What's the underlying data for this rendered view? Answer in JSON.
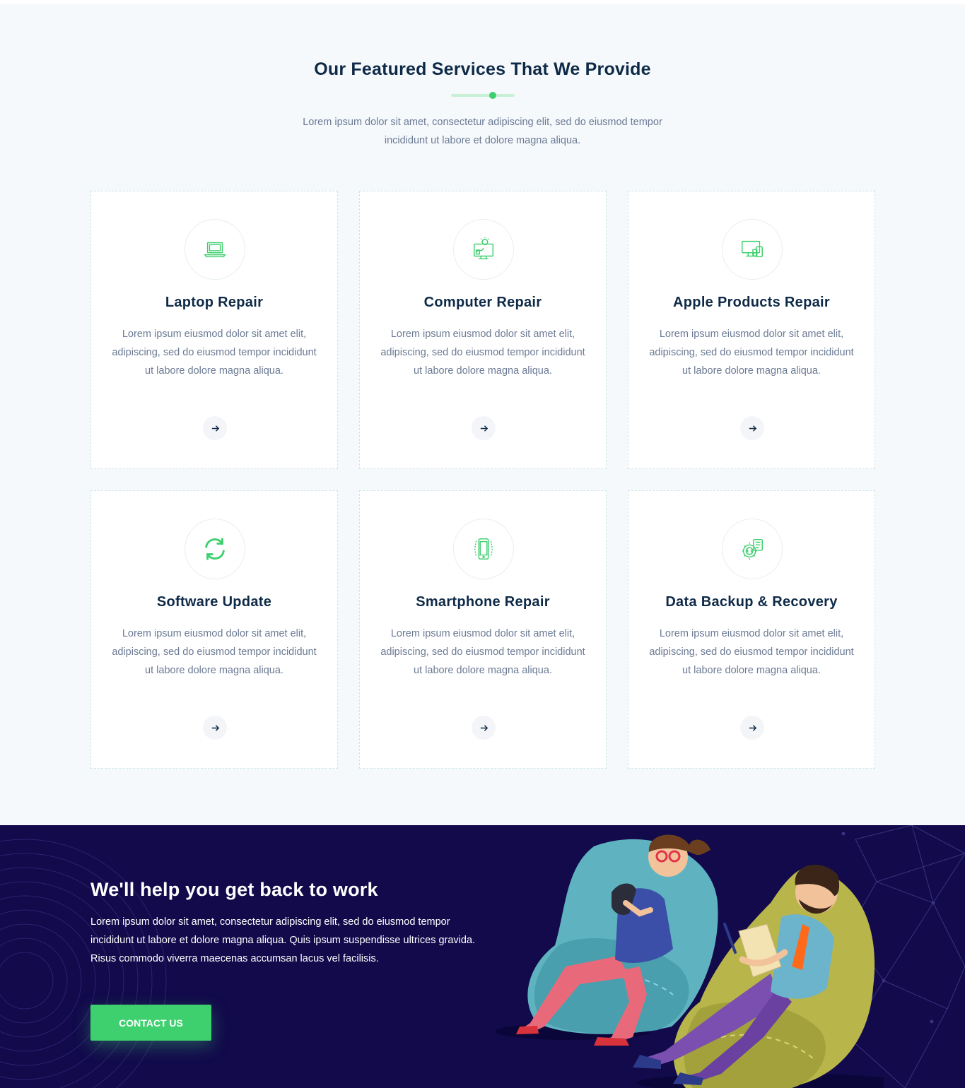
{
  "services_section": {
    "title": "Our Featured Services That We Provide",
    "subtitle": "Lorem ipsum dolor sit amet, consectetur adipiscing elit, sed do eiusmod tempor incididunt ut labore et dolore magna aliqua."
  },
  "cards": [
    {
      "title": "Laptop Repair",
      "text": "Lorem ipsum eiusmod dolor sit amet elit, adipiscing, sed do eiusmod tempor incididunt ut labore dolore magna aliqua.",
      "icon": "laptop-icon"
    },
    {
      "title": "Computer Repair",
      "text": "Lorem ipsum eiusmod dolor sit amet elit, adipiscing, sed do eiusmod tempor incididunt ut labore dolore magna aliqua.",
      "icon": "computer-icon"
    },
    {
      "title": "Apple Products Repair",
      "text": "Lorem ipsum eiusmod dolor sit amet elit, adipiscing, sed do eiusmod tempor incididunt ut labore dolore magna aliqua.",
      "icon": "devices-icon"
    },
    {
      "title": "Software Update",
      "text": "Lorem ipsum eiusmod dolor sit amet elit, adipiscing, sed do eiusmod tempor incididunt ut labore dolore magna aliqua.",
      "icon": "refresh-icon"
    },
    {
      "title": "Smartphone Repair",
      "text": "Lorem ipsum eiusmod dolor sit amet elit, adipiscing, sed do eiusmod tempor incididunt ut labore dolore magna aliqua.",
      "icon": "smartphone-icon"
    },
    {
      "title": "Data Backup & Recovery",
      "text": "Lorem ipsum eiusmod dolor sit amet elit, adipiscing, sed do eiusmod tempor incididunt ut labore dolore magna aliqua.",
      "icon": "data-gear-icon"
    }
  ],
  "cta": {
    "title": "We'll help you get back to work",
    "text": "Lorem ipsum dolor sit amet, consectetur adipiscing elit, sed do eiusmod tempor incididunt ut labore et dolore magna aliqua. Quis ipsum suspendisse ultrices gravida. Risus commodo viverra maecenas accumsan lacus vel facilisis.",
    "button_label": "CONTACT US"
  },
  "colors": {
    "accent": "#3ecf6e",
    "heading": "#0e2a47",
    "body_text": "#6b7a94",
    "cta_background": "#120a4b"
  }
}
